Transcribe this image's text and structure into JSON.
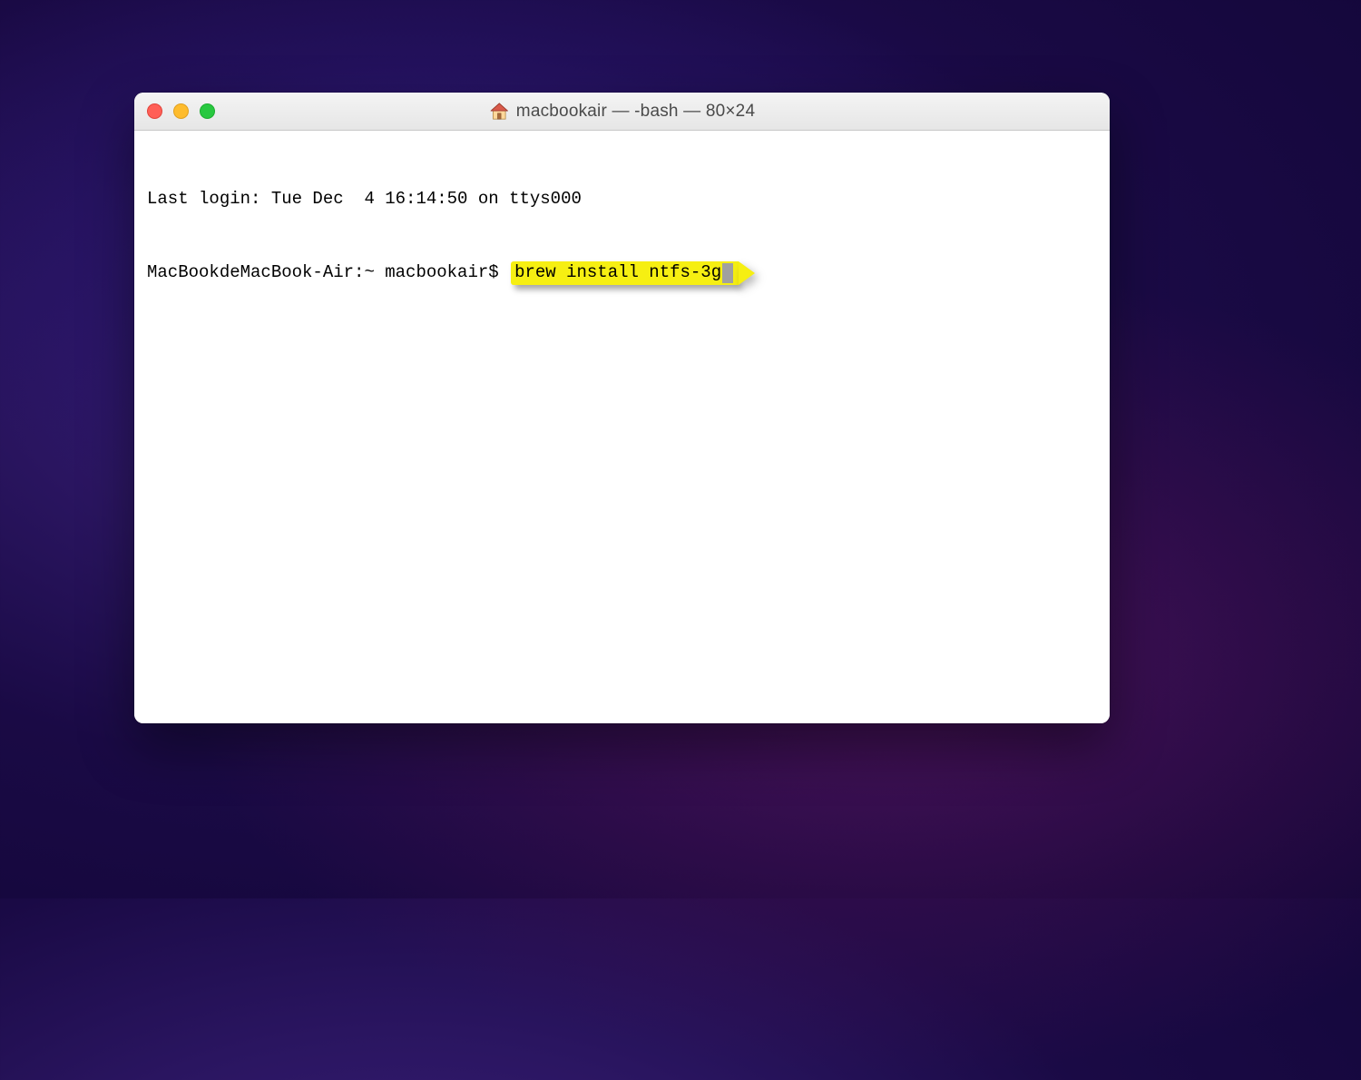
{
  "window": {
    "title": "macbookair — -bash — 80×24",
    "icon_name": "home-icon"
  },
  "terminal": {
    "line1": "Last login: Tue Dec  4 16:14:50 on ttys000",
    "prompt": "MacBookdeMacBook-Air:~ macbookair$ ",
    "command": "brew install ntfs-3g"
  },
  "colors": {
    "close": "#ff5f57",
    "minimize": "#febc2e",
    "zoom": "#28c840",
    "highlight": "#f6ef12"
  }
}
